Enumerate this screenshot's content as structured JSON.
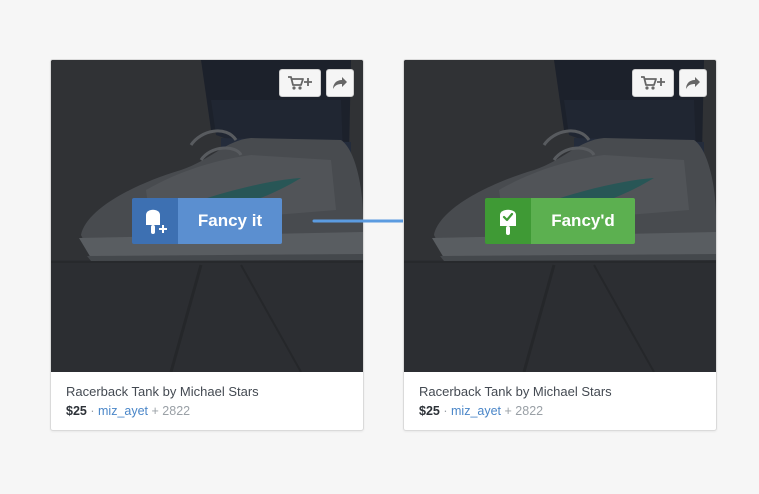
{
  "cards": [
    {
      "product_title": "Racerback Tank by Michael Stars",
      "price": "$25",
      "separator": "·",
      "username": "miz_ayet",
      "count": "+ 2822",
      "fancy_label": "Fancy it",
      "state": "default"
    },
    {
      "product_title": "Racerback Tank by Michael Stars",
      "price": "$25",
      "separator": "·",
      "username": "miz_ayet",
      "count": "+ 2822",
      "fancy_label": "Fancy'd",
      "state": "fancied"
    }
  ],
  "icons": {
    "cart": "cart-add-icon",
    "share": "share-arrow-icon",
    "fancy": "popsicle-plus-icon",
    "fancied": "popsicle-check-icon",
    "transition": "right-arrow-icon"
  },
  "colors": {
    "fancy_blue": "#5b8fd0",
    "fancy_blue_dark": "#3d70b2",
    "fancy_green": "#5cb050",
    "fancy_green_dark": "#3f9a35",
    "arrow": "#5b9be0",
    "link": "#4a86c8"
  }
}
